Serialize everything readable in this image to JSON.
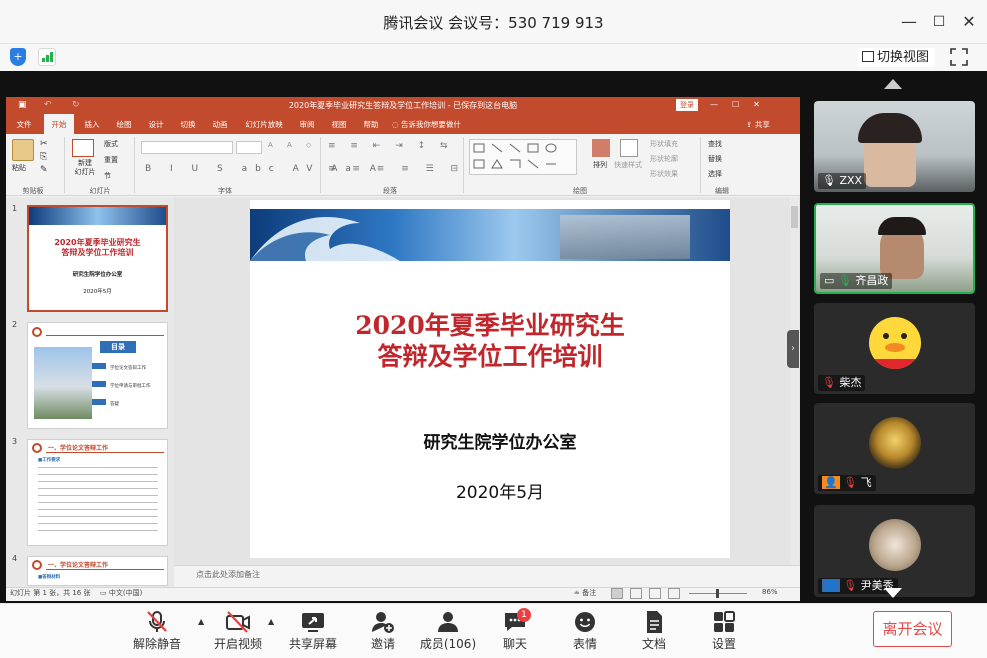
{
  "window": {
    "title": "腾讯会议 会议号：530 719 913",
    "minimize": "—",
    "maximize": "☐",
    "close": "✕"
  },
  "topbar": {
    "switch_view": "切换视图"
  },
  "ppt": {
    "title": "2020年夏季毕业研究生答辩及学位工作培训 - 已保存到这台电脑",
    "login": "登录",
    "tabs": [
      "文件",
      "开始",
      "插入",
      "绘图",
      "设计",
      "切换",
      "动画",
      "幻灯片放映",
      "审阅",
      "视图",
      "帮助"
    ],
    "tell_me": "告诉我你想要做什么",
    "share": "共享",
    "groups": [
      "剪贴板",
      "幻灯片",
      "字体",
      "段落",
      "绘图",
      "编辑"
    ],
    "ribbon": {
      "paste": "粘贴",
      "new_slide": "新建\n幻灯片",
      "layout": "版式",
      "reset": "重置",
      "section": "节",
      "arrange": "排列",
      "quick_styles": "快速样式",
      "shape_fill": "形状填充",
      "shape_outline": "形状轮廓",
      "shape_effect": "形状效果",
      "find": "查找",
      "replace": "替换",
      "select": "选择"
    },
    "thumbnails": [
      {
        "num": "1",
        "title": "2020年夏季毕业研究生答辩及学位工作培训",
        "org": "研究生院学位办公室",
        "date": "2020年5月"
      },
      {
        "num": "2",
        "heading": "目录",
        "items": [
          "学位论文答辩工作",
          "学位申请与审批工作",
          "答疑"
        ]
      },
      {
        "num": "3",
        "heading": "一、学位论文答辩工作",
        "sub": "■工作要求"
      },
      {
        "num": "4",
        "heading": "一、学位论文答辩工作",
        "sub": "■答辩材料"
      }
    ],
    "slide": {
      "title_line1": "2020年夏季毕业研究生",
      "title_line2": "答辩及学位工作培训",
      "org": "研究生院学位办公室",
      "date": "2020年5月"
    },
    "notes_placeholder": "点击此处添加备注",
    "status_left": "幻灯片 第 1 张，共 16 张",
    "status_lang": "中文(中国)",
    "status_notes": "备注",
    "zoom": "86%"
  },
  "participants": [
    {
      "name": "ZXX",
      "type": "video"
    },
    {
      "name": "齐昌政",
      "type": "video"
    },
    {
      "name": "柴杰",
      "type": "avatar"
    },
    {
      "name": "飞",
      "type": "avatar"
    },
    {
      "name": "尹美秀",
      "type": "avatar"
    }
  ],
  "toolbar": {
    "mute": "解除静音",
    "video": "开启视频",
    "share": "共享屏幕",
    "invite": "邀请",
    "members": "成员(106)",
    "chat": "聊天",
    "chat_badge": "1",
    "reactions": "表情",
    "docs": "文档",
    "settings": "设置",
    "leave": "离开会议"
  },
  "colors": {
    "ppt_accent": "#c24a2d",
    "slide_title": "#c0272d",
    "leave": "#e04b4b",
    "active_speaker": "#22b14c"
  }
}
